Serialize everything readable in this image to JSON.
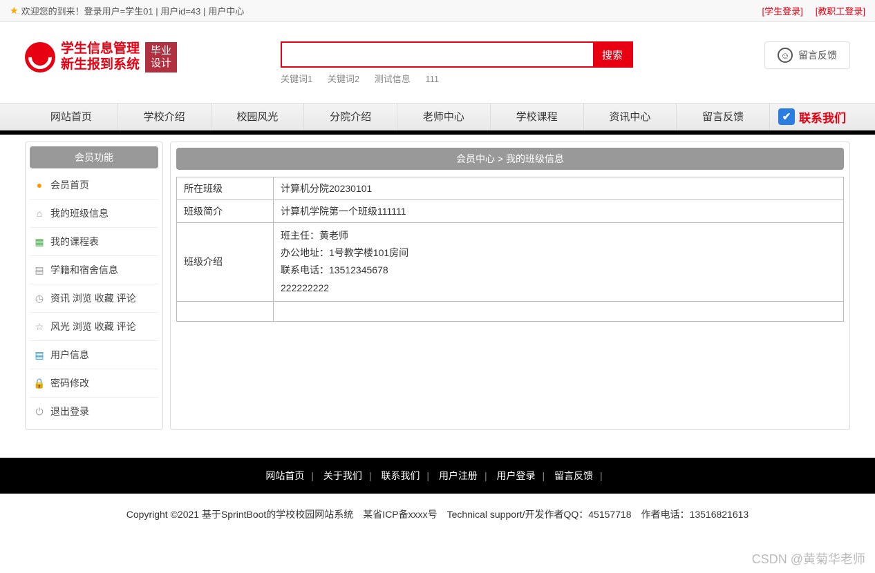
{
  "topbar": {
    "welcome": "欢迎您的到来！登录用户=学生01 | 用户id=43 | ",
    "usercenter": "用户中心",
    "login_student": "[学生登录]",
    "login_staff": "[教职工登录]"
  },
  "logo": {
    "line1": "学生信息管理",
    "line2": "新生报到系统",
    "tag1": "毕业",
    "tag2": "设计"
  },
  "search": {
    "placeholder": "",
    "button": "搜索",
    "kw1": "关键词1",
    "kw2": "关键词2",
    "kw3": "测试信息",
    "kw4": "111"
  },
  "feedback_btn": "留言反馈",
  "nav": {
    "n1": "网站首页",
    "n2": "学校介绍",
    "n3": "校园风光",
    "n4": "分院介绍",
    "n5": "老师中心",
    "n6": "学校课程",
    "n7": "资讯中心",
    "n8": "留言反馈",
    "contact": "联系我们"
  },
  "sidebar": {
    "title": "会员功能",
    "m1": "会员首页",
    "m2": "我的班级信息",
    "m3": "我的课程表",
    "m4": "学籍和宿舍信息",
    "m5": "资讯 浏览 收藏 评论",
    "m6": "风光 浏览 收藏 评论",
    "m7": "用户信息",
    "m8": "密码修改",
    "m9": "退出登录"
  },
  "breadcrumb": "会员中心 > 我的班级信息",
  "table": {
    "r1l": "所在班级",
    "r1v": "计算机分院20230101",
    "r2l": "班级简介",
    "r2v": "计算机学院第一个班级111111",
    "r3l": "班级介绍",
    "r3a": "班主任：黄老师",
    "r3b": "办公地址：1号教学楼101房间",
    "r3c": "联系电话：13512345678",
    "r3d": "222222222"
  },
  "footer": {
    "f1": "网站首页",
    "f2": "关于我们",
    "f3": "联系我们",
    "f4": "用户注册",
    "f5": "用户登录",
    "f6": "留言反馈"
  },
  "copyright": "Copyright ©2021 基于SprintBoot的学校校园网站系统　某省ICP备xxxx号　Technical support/开发作者QQ：45157718　作者电话：13516821613",
  "watermark": "CSDN @黄菊华老师"
}
